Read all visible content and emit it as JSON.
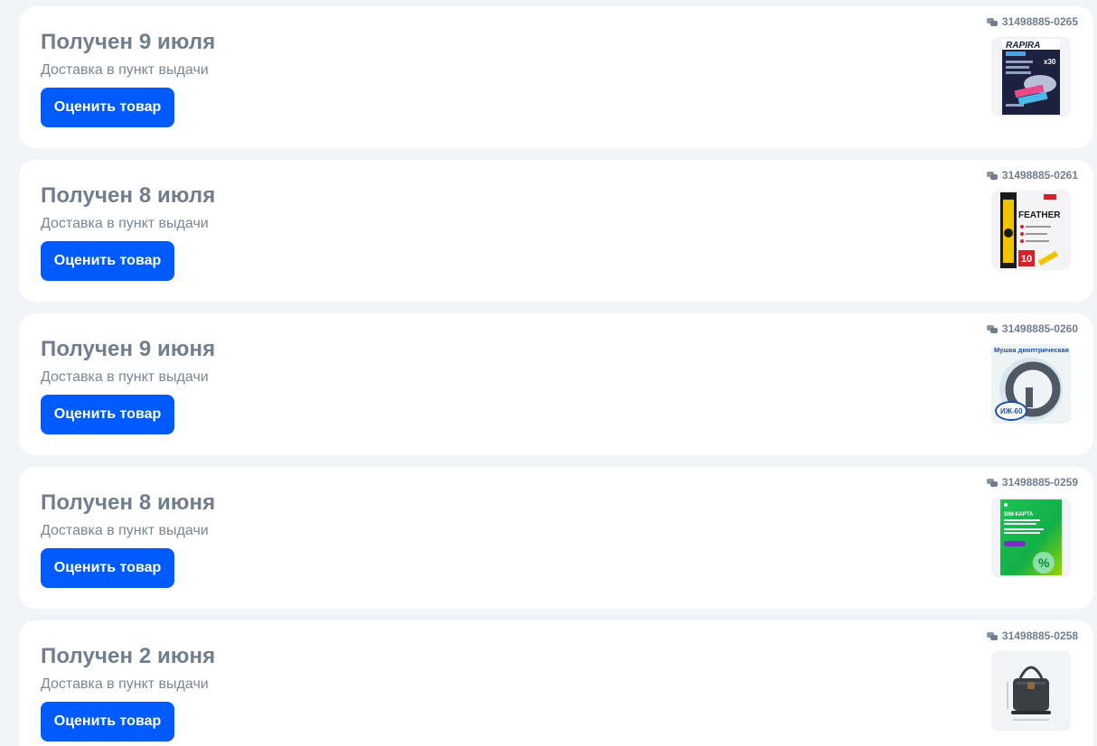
{
  "orders": [
    {
      "title": "Получен 9 июля",
      "subtitle": "Доставка в пункт выдачи",
      "button_label": "Оценить товар",
      "order_number": "31498885-0265",
      "image_text": "RAPIRA",
      "image_badge": "x30"
    },
    {
      "title": "Получен 8 июля",
      "subtitle": "Доставка в пункт выдачи",
      "button_label": "Оценить товар",
      "order_number": "31498885-0261",
      "image_text": "FEATHER",
      "image_badge": "10"
    },
    {
      "title": "Получен 9 июня",
      "subtitle": "Доставка в пункт выдачи",
      "button_label": "Оценить товар",
      "order_number": "31498885-0260",
      "image_text": "Мушка диоптрическая",
      "image_badge": "ИЖ-60"
    },
    {
      "title": "Получен 8 июня",
      "subtitle": "Доставка в пункт выдачи",
      "button_label": "Оценить товар",
      "order_number": "31498885-0259",
      "image_text": "SIM-КАРТА",
      "image_badge": "%"
    },
    {
      "title": "Получен 2 июня",
      "subtitle": "Доставка в пункт выдачи",
      "button_label": "Оценить товар",
      "order_number": "31498885-0258",
      "image_text": "",
      "image_badge": ""
    }
  ],
  "colors": {
    "accent": "#005bff",
    "page_background": "#f3f4f8",
    "card_background": "#ffffff",
    "title_text": "#707e90"
  },
  "icons": {
    "order_number": "chat-bubbles-icon"
  }
}
